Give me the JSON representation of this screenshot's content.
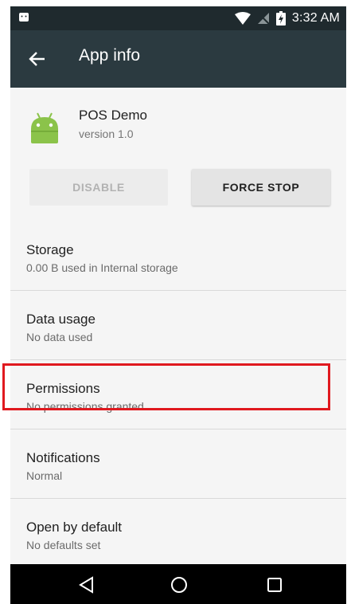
{
  "status_bar": {
    "time": "3:32 AM",
    "icons": [
      "android-notification-icon",
      "wifi-icon",
      "no-sim-icon",
      "battery-charging-icon"
    ]
  },
  "app_bar": {
    "title": "App info",
    "back_icon": "arrow-back-icon"
  },
  "app": {
    "name": "POS Demo",
    "version": "version 1.0",
    "icon": "android-app-icon"
  },
  "actions": {
    "disable_label": "DISABLE",
    "force_stop_label": "FORCE STOP"
  },
  "settings": [
    {
      "title": "Storage",
      "subtitle": "0.00 B used in Internal storage"
    },
    {
      "title": "Data usage",
      "subtitle": "No data used"
    },
    {
      "title": "Permissions",
      "subtitle": "No permissions granted"
    },
    {
      "title": "Notifications",
      "subtitle": "Normal"
    },
    {
      "title": "Open by default",
      "subtitle": "No defaults set"
    }
  ],
  "nav_bar": {
    "icons": [
      "back-triangle-icon",
      "home-circle-icon",
      "recents-square-icon"
    ]
  },
  "colors": {
    "status_bar": "#1f2a2e",
    "app_bar": "#2b3a40",
    "highlight": "#e0191f",
    "android_green": "#8bc34a"
  }
}
